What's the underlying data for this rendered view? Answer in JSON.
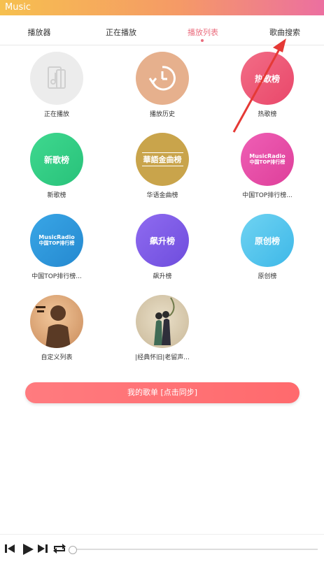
{
  "app": {
    "title": "Music"
  },
  "tabs": [
    {
      "label": "播放器"
    },
    {
      "label": "正在播放"
    },
    {
      "label": "播放列表"
    },
    {
      "label": "歌曲搜索"
    }
  ],
  "playlists": [
    {
      "label": "正在播放",
      "art": "正在播放"
    },
    {
      "label": "播放历史",
      "art": ""
    },
    {
      "label": "热歌榜",
      "art": "热歌榜"
    },
    {
      "label": "新歌榜",
      "art": "新歌榜"
    },
    {
      "label": "华语金曲榜",
      "art": "華語金曲榜"
    },
    {
      "label": "中国TOP排行榜...",
      "art_top": "MusicRadio",
      "art_bottom": "中国TOP排行榜"
    },
    {
      "label": "中国TOP排行榜...",
      "art_top": "MusicRadio",
      "art_bottom": "中国TOP排行榜"
    },
    {
      "label": "飙升榜",
      "art": "飙升榜"
    },
    {
      "label": "原创榜",
      "art": "原创榜"
    },
    {
      "label": "自定义列表",
      "art": ""
    },
    {
      "label": "|经典怀旧|老留声...",
      "art": ""
    }
  ],
  "my_playlist_button": {
    "label": "我的歌单 [点击同步]"
  },
  "colors": {
    "accent": "#ea6d7e",
    "header_gradient": [
      "#f6c04f",
      "#ec6fa0"
    ],
    "cta": "#ff6f72"
  },
  "player": {
    "progress_fraction": 0.0
  }
}
